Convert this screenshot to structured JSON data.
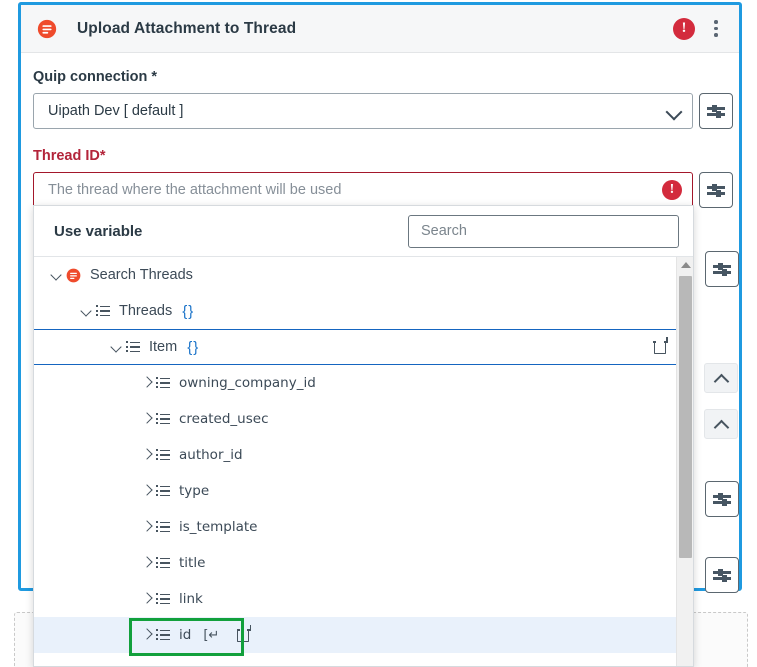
{
  "header": {
    "logo_icon": "quip-logo-icon",
    "title": "Upload Attachment to Thread",
    "error_badge": "!",
    "menu_icon": "kebab-menu-icon"
  },
  "fields": [
    {
      "label": "Quip connection *",
      "required": true,
      "value": "Uipath Dev [ default ]",
      "placeholder": "",
      "type": "select",
      "has_error": false,
      "aux_icon": "sliders-icon"
    },
    {
      "label": "Thread ID*",
      "required": true,
      "value": "",
      "placeholder": "The thread where the attachment will be used",
      "type": "text",
      "has_error": true,
      "error_glyph": "!",
      "aux_icon": "sliders-icon"
    }
  ],
  "hidden_aux_buttons": [
    {
      "aux_icon": "sliders-icon"
    },
    {
      "aux_icon": "sliders-icon"
    },
    {
      "aux_icon": "sliders-icon"
    }
  ],
  "collapse_buttons": [
    {
      "icon": "chevron-up-icon"
    },
    {
      "icon": "chevron-up-icon"
    }
  ],
  "picker": {
    "title": "Use variable",
    "search": {
      "placeholder": "Search",
      "value": ""
    },
    "tree": [
      {
        "label": "Search Threads",
        "indent": 0,
        "twisty": "down",
        "icon": "quip-logo-icon",
        "braces": "",
        "selected": false,
        "highlight": false,
        "copy": false,
        "return_glyph": ""
      },
      {
        "label": "Threads",
        "indent": 1,
        "twisty": "down",
        "icon": "list-icon",
        "braces": "{}",
        "selected": false,
        "highlight": false,
        "copy": false,
        "return_glyph": ""
      },
      {
        "label": "Item",
        "indent": 2,
        "twisty": "down",
        "icon": "list-icon",
        "braces": "{}",
        "selected": true,
        "highlight": false,
        "copy": true,
        "return_glyph": ""
      },
      {
        "label": "owning_company_id",
        "indent": 3,
        "twisty": "right",
        "icon": "list-icon",
        "braces": "",
        "selected": false,
        "highlight": false,
        "copy": false,
        "return_glyph": ""
      },
      {
        "label": "created_usec",
        "indent": 3,
        "twisty": "right",
        "icon": "list-icon",
        "braces": "",
        "selected": false,
        "highlight": false,
        "copy": false,
        "return_glyph": ""
      },
      {
        "label": "author_id",
        "indent": 3,
        "twisty": "right",
        "icon": "list-icon",
        "braces": "",
        "selected": false,
        "highlight": false,
        "copy": false,
        "return_glyph": ""
      },
      {
        "label": "type",
        "indent": 3,
        "twisty": "right",
        "icon": "list-icon",
        "braces": "",
        "selected": false,
        "highlight": false,
        "copy": false,
        "return_glyph": ""
      },
      {
        "label": "is_template",
        "indent": 3,
        "twisty": "right",
        "icon": "list-icon",
        "braces": "",
        "selected": false,
        "highlight": false,
        "copy": false,
        "return_glyph": ""
      },
      {
        "label": "title",
        "indent": 3,
        "twisty": "right",
        "icon": "list-icon",
        "braces": "",
        "selected": false,
        "highlight": false,
        "copy": false,
        "return_glyph": ""
      },
      {
        "label": "link",
        "indent": 3,
        "twisty": "right",
        "icon": "list-icon",
        "braces": "",
        "selected": false,
        "highlight": false,
        "copy": false,
        "return_glyph": ""
      },
      {
        "label": "id",
        "indent": 3,
        "twisty": "right",
        "icon": "list-icon",
        "braces": "",
        "selected": false,
        "highlight": true,
        "copy": true,
        "return_glyph": "[↵"
      }
    ],
    "annotated_row_label": "id",
    "scrollbar": {
      "icon": "scroll-up-arrow-icon"
    }
  },
  "colors": {
    "panel_border": "#1f9ae0",
    "error_red": "#d32b3d",
    "label_red": "#b3243a",
    "annotation_green": "#12a03c",
    "row_highlight": "#e9f1fb",
    "brace_blue": "#1a73c9",
    "quip_orange": "#ef4b2c"
  }
}
